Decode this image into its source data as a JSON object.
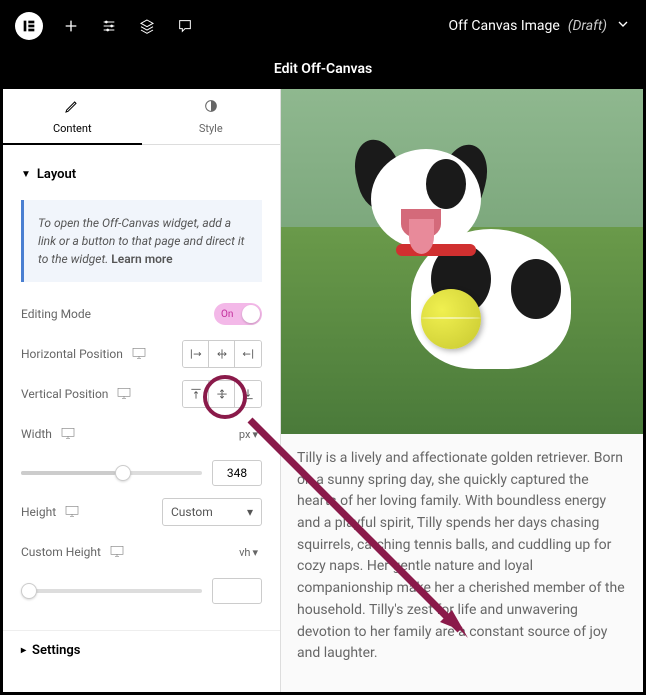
{
  "topbar": {
    "page_title": "Off Canvas Image",
    "draft_label": "(Draft)"
  },
  "header": {
    "title": "Edit Off-Canvas"
  },
  "tabs": {
    "content": "Content",
    "style": "Style"
  },
  "sections": {
    "layout": "Layout",
    "settings": "Settings"
  },
  "info": {
    "text": "To open the Off-Canvas widget, add a link or a button to that page and direct it to the widget.",
    "learn": "Learn more"
  },
  "controls": {
    "editing_mode": {
      "label": "Editing Mode",
      "value": "On"
    },
    "horizontal_position": {
      "label": "Horizontal Position"
    },
    "vertical_position": {
      "label": "Vertical Position"
    },
    "width": {
      "label": "Width",
      "unit": "px",
      "value": "348"
    },
    "height": {
      "label": "Height",
      "value": "Custom"
    },
    "custom_height": {
      "label": "Custom Height",
      "unit": "vh",
      "value": ""
    }
  },
  "preview": {
    "text": "Tilly is a lively and affectionate golden retriever. Born on a sunny spring day, she quickly captured the hearts of her loving family. With boundless energy and a playful spirit, Tilly spends her days chasing squirrels, catching tennis balls, and cuddling up for cozy naps. Her gentle nature and loyal companionship make her a cherished member of the household. Tilly's zest for life and unwavering devotion to her family are a constant source of joy and laughter."
  }
}
